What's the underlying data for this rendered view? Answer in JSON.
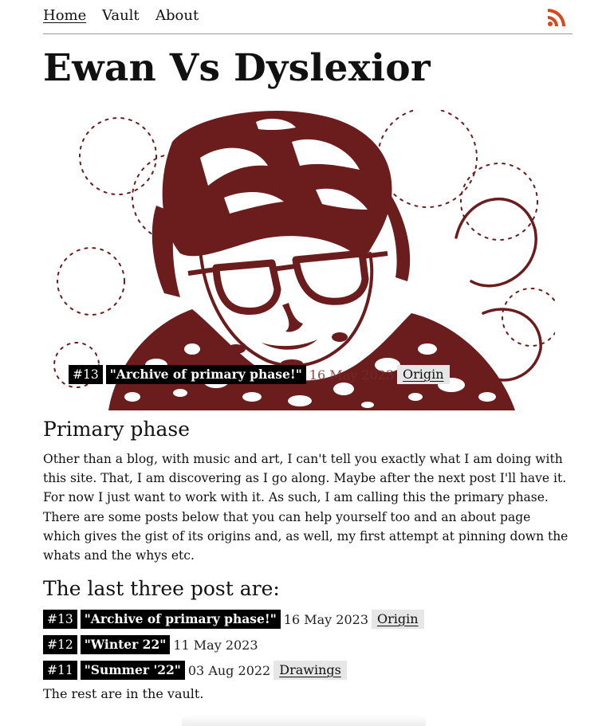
{
  "nav": {
    "items": [
      {
        "label": "Home",
        "active": true
      },
      {
        "label": "Vault",
        "active": false
      },
      {
        "label": "About",
        "active": false
      }
    ],
    "rss_icon": "rss-feed-icon",
    "rss_color": "#d9481a"
  },
  "site_title": "Ewan Vs Dyslexior",
  "hero": {
    "image": "stylized-portrait-illustration",
    "image_color": "#6b1c1c",
    "number": "#13",
    "title": "\"Archive of primary phase!\"",
    "date": "16 May 2023",
    "tag": "Origin"
  },
  "section": {
    "heading": "Primary phase",
    "body": "Other than a blog, with music and art, I can't tell you exactly what I am doing with this site. That, I am discovering as I go along. Maybe after the next post I'll have it. For now I just want to work with it. As such, I am calling this the primary phase. There are some posts below that you can help yourself too and an about page which gives the gist of its origins and, as well, my first attempt at pinning down the whats and the whys etc."
  },
  "last_posts": {
    "heading": "The last three post are:",
    "posts": [
      {
        "number": "#13",
        "title": "\"Archive of primary phase!\"",
        "date": "16 May 2023",
        "tag": "Origin"
      },
      {
        "number": "#12",
        "title": "\"Winter 22\"",
        "date": "11 May 2023",
        "tag": ""
      },
      {
        "number": "#11",
        "title": "\"Summer '22\"",
        "date": "03 Aug 2022",
        "tag": "Drawings"
      }
    ]
  },
  "rest_text": "The rest are in the vault."
}
